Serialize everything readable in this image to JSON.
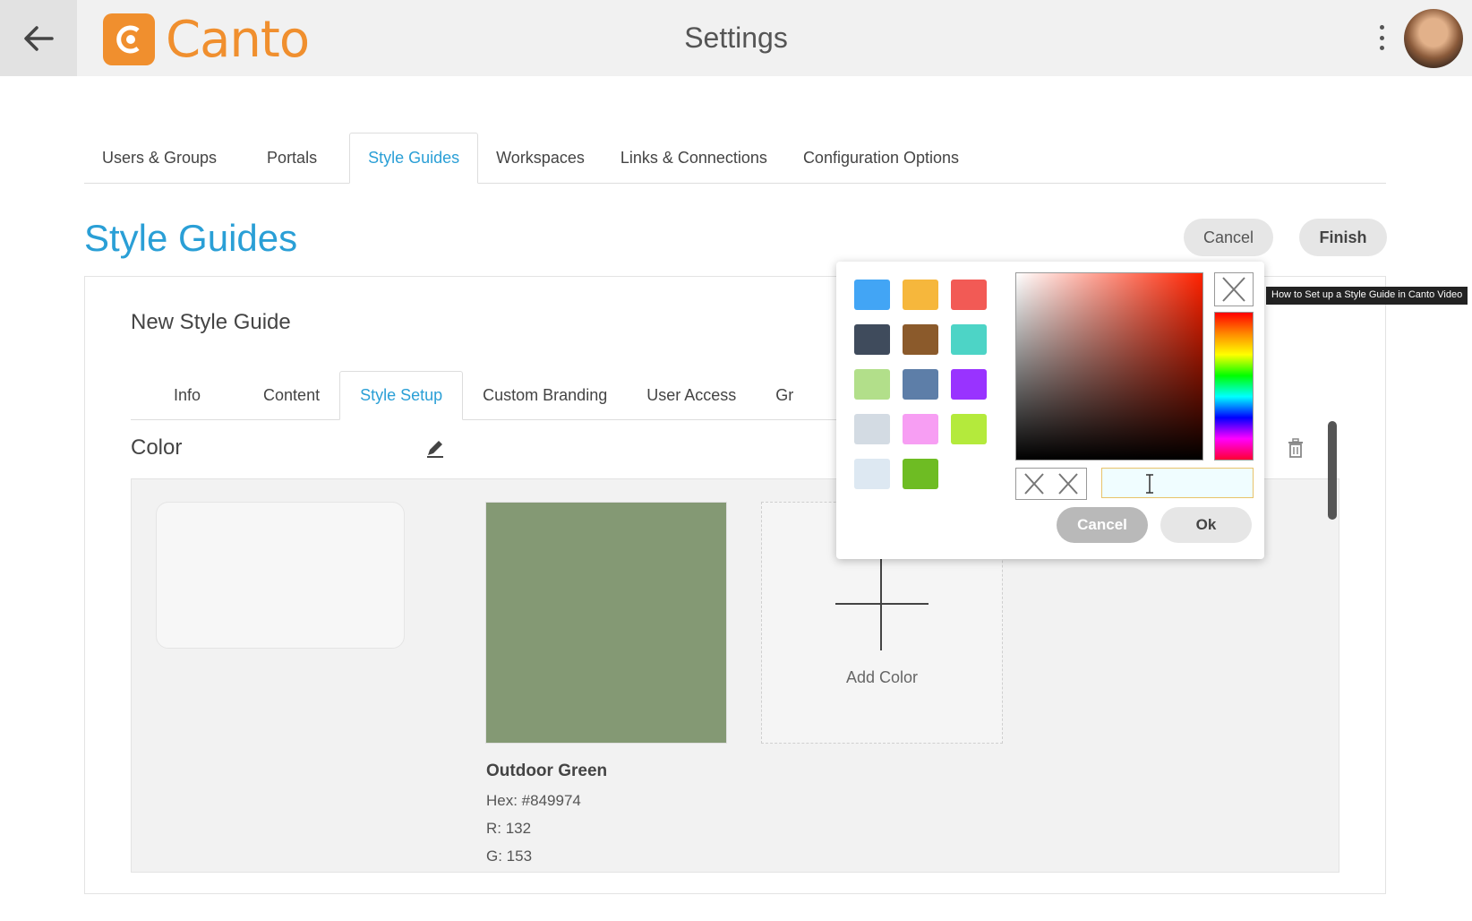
{
  "header": {
    "title": "Settings",
    "logo_text": "Canto",
    "brand_color": "#f08f2e"
  },
  "main_tabs": [
    {
      "label": "Users & Groups"
    },
    {
      "label": "Portals"
    },
    {
      "label": "Style Guides"
    },
    {
      "label": "Workspaces"
    },
    {
      "label": "Links & Connections"
    },
    {
      "label": "Configuration Options"
    }
  ],
  "section": {
    "title": "Style Guides",
    "cancel_label": "Cancel",
    "finish_label": "Finish"
  },
  "style_guide": {
    "title": "New Style Guide",
    "tabs": [
      {
        "label": "Info"
      },
      {
        "label": "Content"
      },
      {
        "label": "Style Setup"
      },
      {
        "label": "Custom Branding"
      },
      {
        "label": "User Access"
      },
      {
        "label": "Gr"
      }
    ],
    "color_label": "Color"
  },
  "color_card": {
    "name": "Outdoor Green",
    "hex_line": "Hex: #849974",
    "r_line": "R: 132",
    "g_line": "G: 153",
    "swatch_color": "#849974"
  },
  "add_color": {
    "label": "Add Color"
  },
  "tooltip": "How to Set up a Style Guide in Canto Video",
  "color_picker": {
    "swatches": [
      "#42a5f5",
      "#f6b73c",
      "#f25a55",
      "#3f4b5c",
      "#8b5a2b",
      "#4dd4c6",
      "#b2df8a",
      "#5d7ea8",
      "#9933ff",
      "#d3dbe3",
      "#f79ef3",
      "#b4ea3c",
      "#dde8f2",
      "#6ebc23"
    ],
    "hex_value": "",
    "cancel_label": "Cancel",
    "ok_label": "Ok"
  }
}
